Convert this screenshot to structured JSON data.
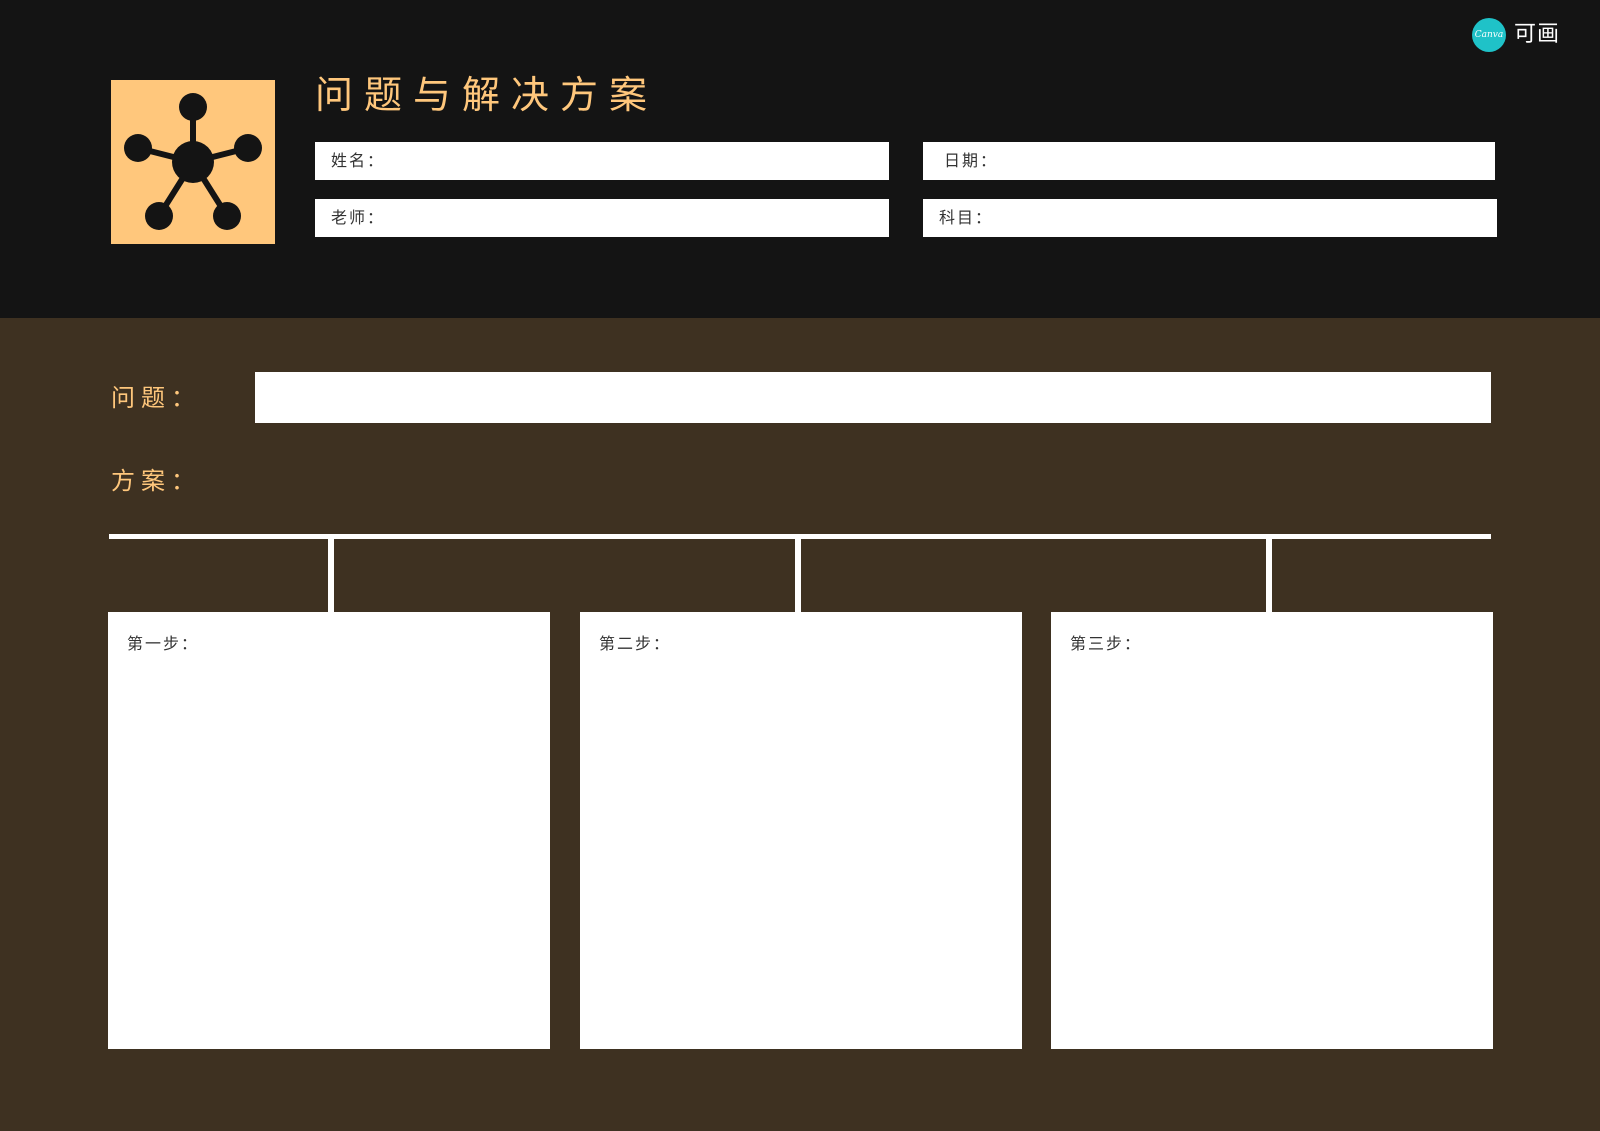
{
  "brand": {
    "badge_text": "Canva",
    "name_cn": "可画",
    "badge_color": "#1fc2c8"
  },
  "header": {
    "title": "问题与解决方案",
    "icon": "network-hub-icon",
    "fields": {
      "name": "姓名：",
      "date": "日期：",
      "teacher": "老师：",
      "subject": "科目："
    }
  },
  "main": {
    "problem_label": "问题：",
    "solution_label": "方案：",
    "steps": [
      {
        "label": "第一步："
      },
      {
        "label": "第二步："
      },
      {
        "label": "第三步："
      }
    ]
  },
  "colors": {
    "header_bg": "#141414",
    "body_bg": "#3e3121",
    "accent": "#ffc77c",
    "field_bg": "#ffffff"
  }
}
